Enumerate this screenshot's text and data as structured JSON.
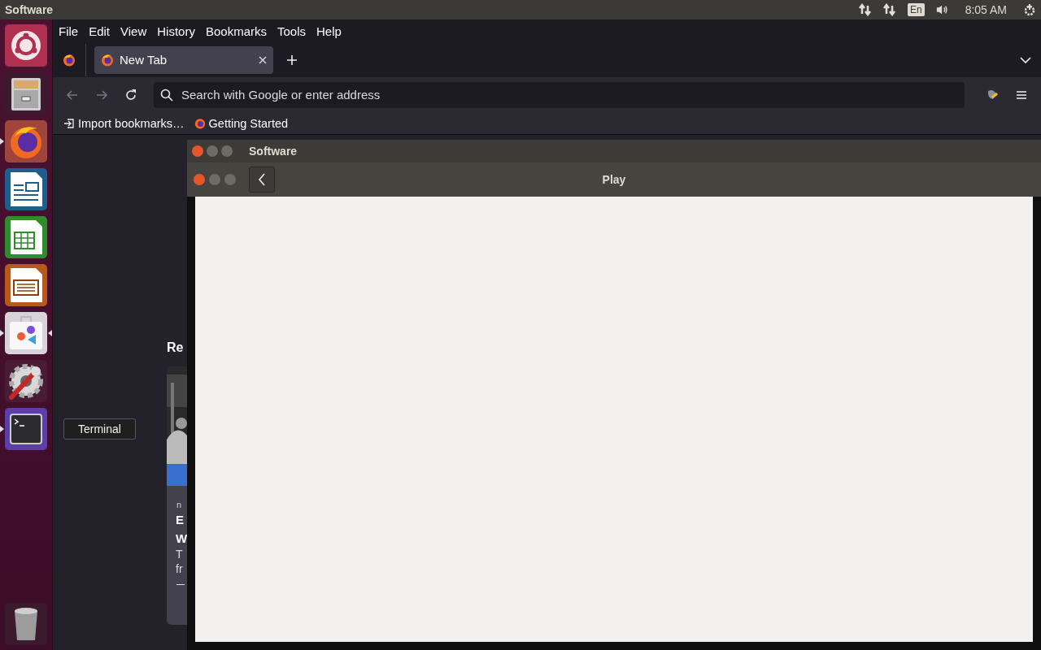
{
  "top_bar": {
    "title": "Software",
    "keyboard": "En",
    "time": "8:05 AM"
  },
  "launcher": {
    "items": [
      {
        "kind": "ubuntu",
        "running": false,
        "focused": false
      },
      {
        "kind": "files",
        "running": false,
        "focused": false
      },
      {
        "kind": "firefox",
        "running": true,
        "focused": false
      },
      {
        "kind": "writer",
        "running": false,
        "focused": false
      },
      {
        "kind": "calc",
        "running": false,
        "focused": false
      },
      {
        "kind": "impress",
        "running": false,
        "focused": false
      },
      {
        "kind": "software",
        "running": true,
        "focused": true
      },
      {
        "kind": "settings",
        "running": false,
        "focused": false
      },
      {
        "kind": "terminal",
        "running": true,
        "focused": false
      }
    ],
    "trash": {
      "kind": "trash"
    },
    "tooltip": "Terminal"
  },
  "browser": {
    "menu": [
      "File",
      "Edit",
      "View",
      "History",
      "Bookmarks",
      "Tools",
      "Help"
    ],
    "tabs": [
      {
        "label": "New Tab",
        "selected": true
      }
    ],
    "address": {
      "placeholder": "Search with Google or enter address"
    },
    "bookmarks": [
      "Import bookmarks…",
      "Getting Started"
    ],
    "content": {
      "heading": "Re",
      "card": {
        "source": "n",
        "title_lines": [
          "E",
          "W"
        ],
        "text_lines": [
          "T",
          "fr"
        ]
      }
    }
  },
  "windows": [
    {
      "title": "Software"
    },
    {
      "title": "Play"
    }
  ]
}
